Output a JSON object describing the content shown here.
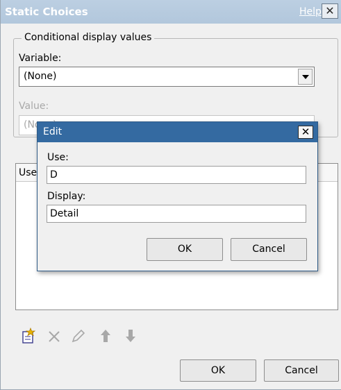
{
  "window": {
    "title": "Static Choices",
    "help_label": "Help",
    "close_glyph": "✕"
  },
  "conditional": {
    "legend": "Conditional display values",
    "variable_label": "Variable:",
    "variable_value": "(None)",
    "value_label": "Value:",
    "value_value": "(None)"
  },
  "table": {
    "columns": [
      "Use"
    ]
  },
  "toolbar": {
    "icons": [
      "new-icon",
      "delete-icon",
      "edit-icon",
      "move-up-icon",
      "move-down-icon"
    ],
    "new_color": "#e8b400"
  },
  "buttons": {
    "ok": "OK",
    "cancel": "Cancel"
  },
  "edit_dialog": {
    "title": "Edit",
    "close_glyph": "✕",
    "use_label": "Use:",
    "use_value": "D",
    "display_label": "Display:",
    "display_value": "Detail",
    "ok": "OK",
    "cancel": "Cancel",
    "title_color": "#346aa1"
  }
}
